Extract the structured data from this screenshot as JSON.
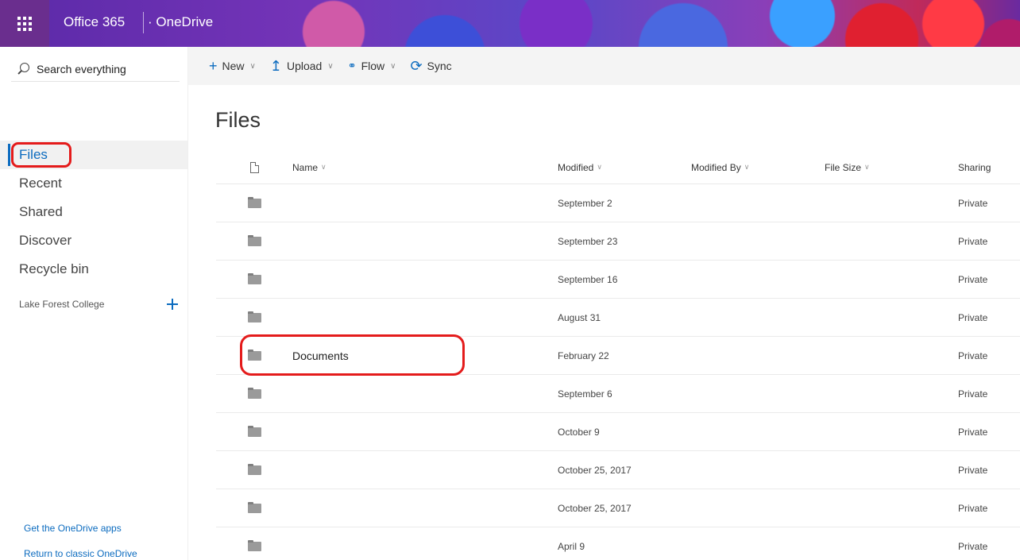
{
  "suitebar": {
    "brand": "Office 365",
    "app": "OneDrive",
    "app_separator": "·"
  },
  "search": {
    "placeholder": "Search everything"
  },
  "nav": {
    "items": [
      {
        "label": "Files",
        "active": true
      },
      {
        "label": "Recent",
        "active": false
      },
      {
        "label": "Shared",
        "active": false
      },
      {
        "label": "Discover",
        "active": false
      },
      {
        "label": "Recycle bin",
        "active": false
      }
    ],
    "group_label": "Lake Forest College",
    "footer": {
      "get_apps": "Get the OneDrive apps",
      "classic": "Return to classic OneDrive"
    }
  },
  "commands": {
    "new": "New",
    "upload": "Upload",
    "flow": "Flow",
    "sync": "Sync"
  },
  "page": {
    "title": "Files"
  },
  "table": {
    "headers": {
      "name": "Name",
      "modified": "Modified",
      "modified_by": "Modified By",
      "file_size": "File Size",
      "sharing": "Sharing"
    },
    "rows": [
      {
        "name": "",
        "modified": "September 2",
        "sharing": "Private"
      },
      {
        "name": "",
        "modified": "September 23",
        "sharing": "Private"
      },
      {
        "name": "",
        "modified": "September 16",
        "sharing": "Private"
      },
      {
        "name": "",
        "modified": "August 31",
        "sharing": "Private"
      },
      {
        "name": "Documents",
        "modified": "February 22",
        "sharing": "Private"
      },
      {
        "name": "",
        "modified": "September 6",
        "sharing": "Private"
      },
      {
        "name": "",
        "modified": "October 9",
        "sharing": "Private"
      },
      {
        "name": "",
        "modified": "October 25, 2017",
        "sharing": "Private"
      },
      {
        "name": "",
        "modified": "October 25, 2017",
        "sharing": "Private"
      },
      {
        "name": "",
        "modified": "April 9",
        "sharing": "Private"
      }
    ]
  },
  "colors": {
    "accent": "#0b6bbf",
    "highlight": "#e41b1b",
    "waffle_bg": "#6a2e8e"
  }
}
